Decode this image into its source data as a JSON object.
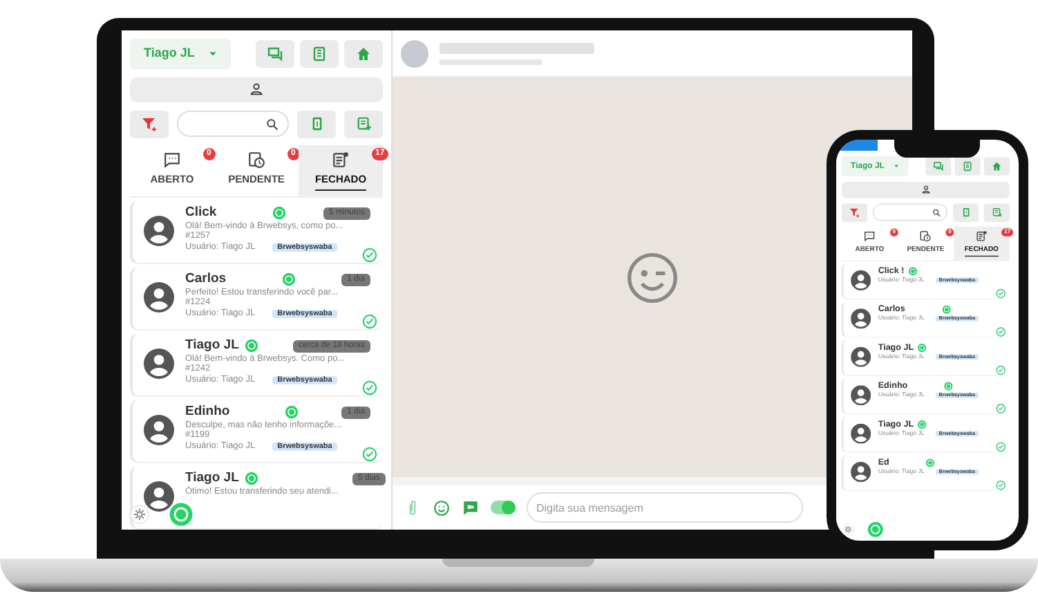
{
  "laptop": {
    "panel": {
      "user": "Tiago JL",
      "tabs": [
        {
          "label": "ABERTO",
          "count": "0",
          "selected": false
        },
        {
          "label": "PENDENTE",
          "count": "0",
          "selected": false
        },
        {
          "label": "FECHADO",
          "count": "17",
          "selected": true
        }
      ],
      "conversations": [
        {
          "name": "Click",
          "preview": "Olá! Bem-vindo à Brwebsys, como po...",
          "ticket": "#1257",
          "user": "Usuário: Tiago JL",
          "tag": "Brwebsyswaba",
          "time": "5 minutos",
          "done": true
        },
        {
          "name": "Carlos",
          "preview": "Perfeito! Estou transferindo você par...",
          "ticket": "#1224",
          "user": "Usuário: Tiago JL",
          "tag": "Brwebsyswaba",
          "time": "1 dia",
          "done": true
        },
        {
          "name": "Tiago JL",
          "preview": "Olá! Bem-vindo à Brwebsys. Como po...",
          "ticket": "#1242",
          "user": "Usuário: Tiago JL",
          "tag": "Brwebsyswaba",
          "time": "cerca de 18 horas",
          "done": true
        },
        {
          "name": "Edinho",
          "preview": "Desculpe, mas não tenho informaçõe...",
          "ticket": "#1199",
          "user": "Usuário: Tiago JL",
          "tag": "Brwebsyswaba",
          "time": "1 dia",
          "done": true
        },
        {
          "name": "Tiago JL",
          "preview": "Ótimo! Estou transferindo seu atendi...",
          "time": "5 dias",
          "done": false
        }
      ]
    },
    "chat": {
      "placeholder": "Digita sua mensagem",
      "toggle_on": true
    }
  },
  "phone": {
    "panel": {
      "user": "Tiago JL",
      "tabs": [
        {
          "label": "ABERTO",
          "count": "0",
          "selected": false
        },
        {
          "label": "PENDENTE",
          "count": "0",
          "selected": false
        },
        {
          "label": "FECHADO",
          "count": "17",
          "selected": true
        }
      ],
      "conversations": [
        {
          "name": "Click !",
          "user": "Usuário: Tiago JL",
          "tag": "Brwebsyswaba",
          "done": true
        },
        {
          "name": "Carlos",
          "user": "Usuário: Tiago JL",
          "tag": "Brwebsyswaba",
          "done": true
        },
        {
          "name": "Tiago JL",
          "user": "Usuário: Tiago JL",
          "tag": "Brwebsyswaba",
          "done": true
        },
        {
          "name": "Edinho",
          "user": "Usuário: Tiago JL",
          "tag": "Brwebsyswaba",
          "done": true
        },
        {
          "name": "Tiago JL",
          "user": "Usuário: Tiago JL",
          "tag": "Brwebsyswaba",
          "done": true
        },
        {
          "name": "Ed",
          "user": "Usuário: Tiago JL",
          "tag": "Brwebsyswaba",
          "done": true
        }
      ]
    }
  }
}
